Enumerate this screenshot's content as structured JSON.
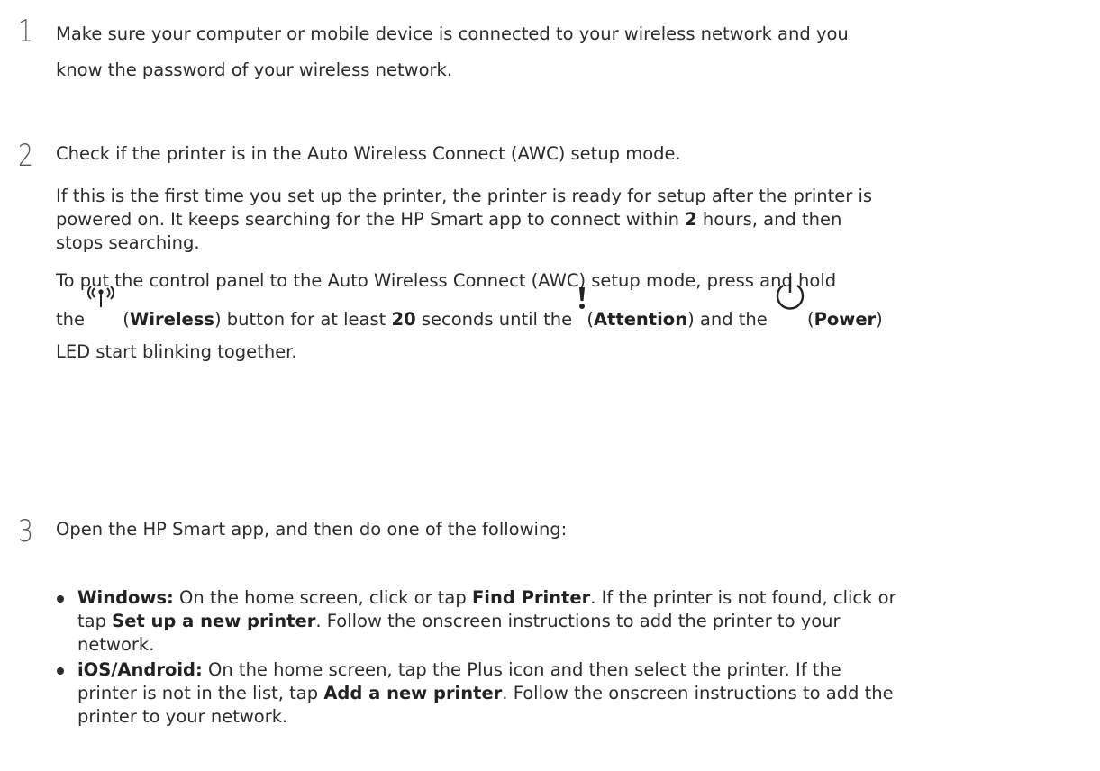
{
  "steps": [
    {
      "number": "1",
      "lines": [
        "Make sure your computer or mobile device is connected to your wireless network and you",
        "know the password of your wireless network."
      ]
    },
    {
      "number": "2",
      "heading": "Check if the printer is in the Auto Wireless Connect (AWC) setup mode.",
      "para1_lines": [
        "If this is the first time you set up the printer, the printer is ready for setup after the printer is",
        "powered on. It keeps searching for the HP Smart app to connect within ",
        "2",
        " hours, and then",
        "stops searching."
      ],
      "para2_line1": "To put the control panel to the Auto Wireless Connect (AWC) setup mode, press and hold",
      "para2_line2": {
        "the": "the",
        "wireless_open": " (",
        "wireless": "Wireless",
        "after_wireless": ") button for at least ",
        "seconds": "20",
        "after_seconds": " seconds until the ",
        "attention_open": "(",
        "attention": "Attention",
        "after_attention": ") and the ",
        "power_open": "(",
        "power": "Power",
        "power_close": ")"
      },
      "para2_line3": "LED start blinking together."
    },
    {
      "number": "3",
      "heading": "Open the HP Smart app, and then do one of the following:",
      "bullets": [
        {
          "label": "Windows:",
          "l1_a": " On the home screen, click or tap ",
          "l1_b": "Find Printer",
          "l1_c": ". If the printer is not found, click or",
          "l2_a": "tap ",
          "l2_b": "Set up a new printer",
          "l2_c": ". Follow the onscreen instructions to add the printer to your",
          "l3": "network."
        },
        {
          "label": "iOS/Android:",
          "l1_a": " On the home screen, tap the Plus icon and then select the printer. If the",
          "l2_a": "printer is not in the list, tap ",
          "l2_b": "Add a new printer",
          "l2_c": ". Follow the onscreen instructions to add the",
          "l3": "printer to your network."
        }
      ]
    }
  ],
  "icons": {
    "wireless": "wireless-icon",
    "attention": "attention-icon",
    "power": "power-icon"
  }
}
